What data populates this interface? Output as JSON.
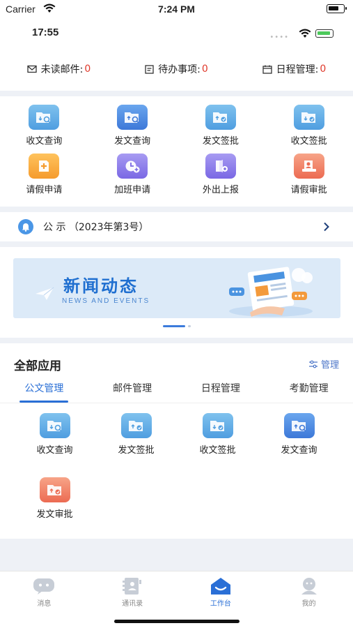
{
  "ios_status": {
    "carrier": "Carrier",
    "time": "7:24 PM"
  },
  "app_status": {
    "time": "17:55"
  },
  "summary": [
    {
      "label": "未读邮件:",
      "count": "0",
      "icon": "mail-icon"
    },
    {
      "label": "待办事项:",
      "count": "0",
      "icon": "todo-icon"
    },
    {
      "label": "日程管理:",
      "count": "0",
      "icon": "calendar-icon"
    }
  ],
  "quick_actions": [
    {
      "label": "收文查询",
      "icon": "folder-search-icon",
      "color": "#5aa6e8"
    },
    {
      "label": "发文查询",
      "icon": "folder-search-icon",
      "color": "#3f7bd9"
    },
    {
      "label": "发文签批",
      "icon": "folder-sign-icon",
      "color": "#5aa6e8"
    },
    {
      "label": "收文签批",
      "icon": "folder-sign-icon",
      "color": "#5aa6e8"
    },
    {
      "label": "请假申请",
      "icon": "leave-request-icon",
      "color": "#f6a838"
    },
    {
      "label": "加班申请",
      "icon": "overtime-icon",
      "color": "#8574e8"
    },
    {
      "label": "外出上报",
      "icon": "outing-icon",
      "color": "#8574e8"
    },
    {
      "label": "请假审批",
      "icon": "leave-approve-icon",
      "color": "#ee7258"
    }
  ],
  "notice": {
    "text": "公 示 （2023年第3号）"
  },
  "banner": {
    "title": "新闻动态",
    "subtitle": "NEWS AND EVENTS"
  },
  "all_apps": {
    "title": "全部应用",
    "manage_label": "管理",
    "tabs": [
      "公文管理",
      "邮件管理",
      "日程管理",
      "考勤管理"
    ],
    "active_tab": 0,
    "items": [
      {
        "label": "收文查询",
        "icon": "folder-search-icon"
      },
      {
        "label": "发文签批",
        "icon": "folder-sign-icon"
      },
      {
        "label": "收文签批",
        "icon": "folder-sign-icon"
      },
      {
        "label": "发文查询",
        "icon": "folder-search-icon"
      },
      {
        "label": "发文审批",
        "icon": "folder-approve-icon"
      }
    ]
  },
  "bottom_nav": [
    {
      "label": "消息",
      "icon": "message-icon"
    },
    {
      "label": "通讯录",
      "icon": "contacts-icon"
    },
    {
      "label": "工作台",
      "icon": "workbench-icon",
      "active": true
    },
    {
      "label": "我的",
      "icon": "profile-icon"
    }
  ],
  "colors": {
    "accent": "#2a6fd6",
    "count": "#e0392b"
  }
}
